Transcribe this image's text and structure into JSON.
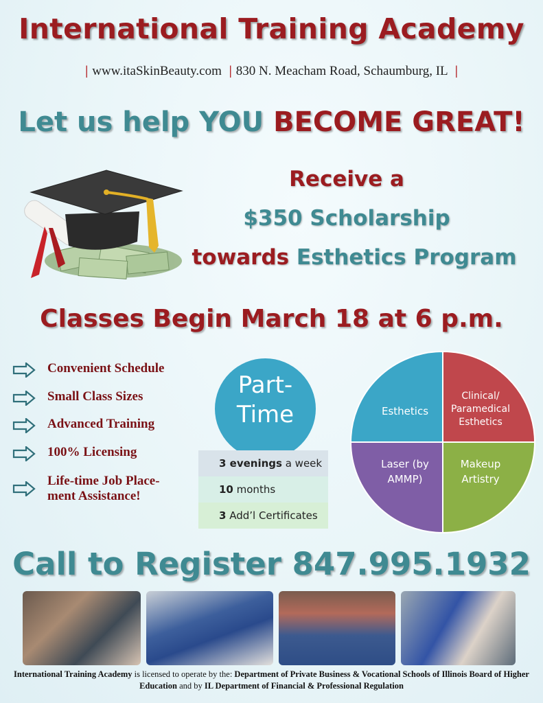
{
  "header": {
    "title": "International Training Academy",
    "website": "www.itaSkinBeauty.com",
    "address": "830 N. Meacham Road, Schaumburg, IL"
  },
  "headline": {
    "part1": "Let us help YOU ",
    "part2": "BECOME GREAT!"
  },
  "scholarship": {
    "line1": "Receive a",
    "line2": "$350 Scholarship",
    "line3_a": "towards ",
    "line3_b": "Esthetics Program"
  },
  "classes": "Classes Begin March 18 at 6 p.m.",
  "benefits": [
    {
      "label": "Convenient Schedule"
    },
    {
      "label": "Small Class Sizes"
    },
    {
      "label": "Advanced Training"
    },
    {
      "label": "100% Licensing"
    },
    {
      "label": "Life-time Job Place-ment Assistance!"
    }
  ],
  "schedule": {
    "badge_line1": "Part-",
    "badge_line2": "Time",
    "rows": [
      {
        "bold": "3 evenings",
        "rest": " a week"
      },
      {
        "bold": "10",
        "rest": " months"
      },
      {
        "bold": "3",
        "rest": " Add’l Certificates"
      }
    ]
  },
  "programs": {
    "quadrants": [
      {
        "label": "Esthetics",
        "color": "#3ba6c7"
      },
      {
        "label": "Clinical/ Paramedical Esthetics",
        "color": "#c0474c"
      },
      {
        "label": "Laser (by AMMP)",
        "color": "#7f5ea6"
      },
      {
        "label": "Makeup Artistry",
        "color": "#8cb046"
      }
    ]
  },
  "cta": "Call to Register 847.995.1932",
  "footer": {
    "name": "International Training Academy",
    "text1": " is licensed to operate by the: ",
    "dept1": "Department of Private Business & Vocational Schools of Illinois Board of Higher Education",
    "text2": " and by ",
    "dept2": "IL Department of Financial & Professional Regulation"
  },
  "colors": {
    "accent_red": "#9b1c20",
    "accent_teal": "#3f8a92"
  }
}
